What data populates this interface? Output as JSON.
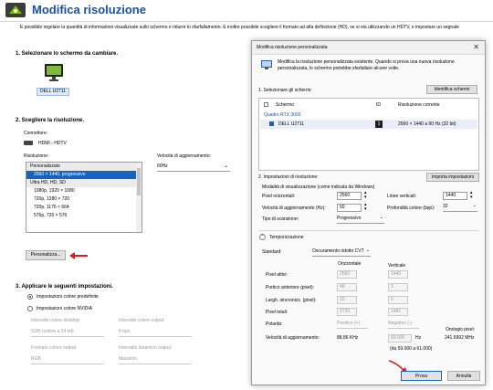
{
  "page": {
    "title": "Modifica risoluzione",
    "intro": "È possibile regolare la quantità di informazioni visualizzate sullo schermo e ridurre lo sfarfallamento. È inoltre possibile scegliere il formato ad alta definizione (HD), se si sta utilizzando un HDTV, e impostare un segnale",
    "step1": "1. Selezionare lo schermo da cambiare.",
    "monitor_label": "DELL U2711",
    "step2": "2. Scegliere la risoluzione.",
    "connector_label": "Connettore:",
    "connector_value": "HDMI - HDTV",
    "resolution_label": "Risoluzione:",
    "refresh_label": "Velocità di aggiornamento:",
    "refresh_value": "60Hz",
    "resolution_list": [
      {
        "text": "Personalizzato",
        "type": "group"
      },
      {
        "text": "2560 × 1440, progressivo",
        "type": "selected"
      },
      {
        "text": "Ultra HD, HD, SD",
        "type": "group"
      },
      {
        "text": "1080p, 1920 × 1080",
        "type": "item"
      },
      {
        "text": "720p, 1280 × 720",
        "type": "item"
      },
      {
        "text": "720p, 1176 × 664",
        "type": "item"
      },
      {
        "text": "576p, 720 × 576",
        "type": "item"
      }
    ],
    "customize_button": "Personalizza...",
    "step3": "3. Applicare le seguenti impostazioni.",
    "radio_default": "Impostazioni colore predefinite",
    "radio_nvidia": "Impostazioni colore NVIDIA",
    "desktop_color_label": "Intensità colore desktop:",
    "desktop_color_value": "SDR (colore a 24 bit)",
    "output_color_label": "Intensità colore output:",
    "output_color_value": "8 bpc",
    "output_format_label": "Formato colore output:",
    "output_format_value": "RGB",
    "dynamic_range_label": "Intervallo dinamico output:",
    "dynamic_range_value": "Massimo"
  },
  "dialog": {
    "title": "Modifica risoluzione personalizzata",
    "description": "Modifica la risoluzione personalizzata esistente. Quando si prova una nuova risoluzione personalizzata, lo schermo potrebbe sfarfallare alcune volte.",
    "section1": "1. Selezionare gli schermi:",
    "identify_button": "Identifica schermi",
    "columns": [
      "Schermo",
      "ID",
      "Risoluzione corrente"
    ],
    "group_row": "Quadro RTX 3000",
    "display_row": {
      "name": "DELL U2711",
      "id": "1",
      "resolution": "2560 × 1440 a 60 Hz (32 bit)"
    },
    "section2": "2. Impostazioni di risoluzione:",
    "import_button": "Importa impostazioni",
    "mode_label": "Modalità di visualizzazione (come indicata da Windows)",
    "h_pixels_label": "Pixel orizzontali:",
    "h_pixels_value": "2560",
    "v_lines_label": "Linee verticali:",
    "v_lines_value": "1440",
    "refresh_label": "Velocità di aggiornamento (Hz):",
    "refresh_value": "60",
    "depth_label": "Profondità colore (bpp):",
    "depth_value": "32",
    "scan_label": "Tipo di scansione:",
    "scan_value": "Progressivo",
    "timing_title": "Temporizzazione",
    "standard_label": "Standard:",
    "standard_value": "Oscuramento ridotto CVT",
    "horizontal_header": "Orizzontale",
    "vertical_header": "Verticale",
    "timing_rows": [
      {
        "label": "Pixel attivi:",
        "h": "2560",
        "v": "1440"
      },
      {
        "label": "Portico anteriore (pixel):",
        "h": "48",
        "v": "3"
      },
      {
        "label": "Largh. sincronizz. (pixel):",
        "h": "32",
        "v": "5"
      },
      {
        "label": "Pixel totali:",
        "h": "2720",
        "v": "1481"
      }
    ],
    "polarity_label": "Polarità:",
    "polarity_h": "Positivo (+)",
    "polarity_v": "Negativo (-)",
    "refresh_rate_label": "Velocità di aggiornamento:",
    "refresh_rate_h": "88.86 KHz",
    "refresh_rate_v": "60.000",
    "hz_unit": "Hz",
    "refresh_range": "(da 59.000 a 61.000)",
    "pixel_clock_label": "Orologio pixel:",
    "pixel_clock_value": "241.6992 MHz",
    "test_button": "Prova",
    "cancel_button": "Annulla"
  },
  "colors": {
    "accent": "#1b4f9c",
    "selection": "#1764c0",
    "annotation": "#d91c1c"
  }
}
